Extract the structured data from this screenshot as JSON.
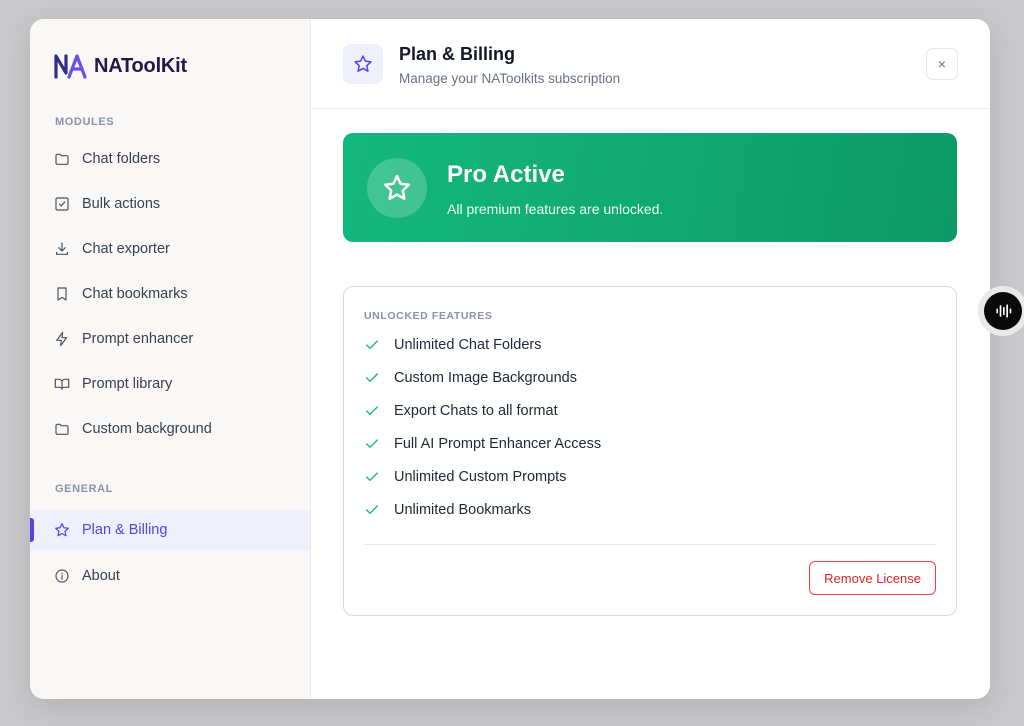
{
  "brand": {
    "name": "NAToolKit"
  },
  "sidebar": {
    "modules_label": "MODULES",
    "general_label": "GENERAL",
    "modules": [
      {
        "label": "Chat folders",
        "icon": "folder-icon"
      },
      {
        "label": "Bulk actions",
        "icon": "checkbox-icon"
      },
      {
        "label": "Chat exporter",
        "icon": "download-icon"
      },
      {
        "label": "Chat bookmarks",
        "icon": "bookmark-icon"
      },
      {
        "label": "Prompt enhancer",
        "icon": "lightning-icon"
      },
      {
        "label": "Prompt library",
        "icon": "book-icon"
      },
      {
        "label": "Custom background",
        "icon": "folder-icon"
      }
    ],
    "general": [
      {
        "label": "Plan & Billing",
        "icon": "star-icon",
        "active": true
      },
      {
        "label": "About",
        "icon": "info-icon",
        "active": false
      }
    ]
  },
  "header": {
    "title": "Plan & Billing",
    "subtitle": "Manage your NAToolkits subscription",
    "close_label": "×"
  },
  "pro_card": {
    "title": "Pro Active",
    "subtitle": "All premium features are unlocked."
  },
  "features": {
    "label": "UNLOCKED FEATURES",
    "items": [
      "Unlimited Chat Folders",
      "Custom Image Backgrounds",
      "Export Chats to all format",
      "Full AI Prompt Enhancer Access",
      "Unlimited Custom Prompts",
      "Unlimited Bookmarks"
    ],
    "remove_label": "Remove License"
  },
  "colors": {
    "accent": "#4f46e5",
    "success": "#10b981",
    "danger": "#dc2626"
  }
}
